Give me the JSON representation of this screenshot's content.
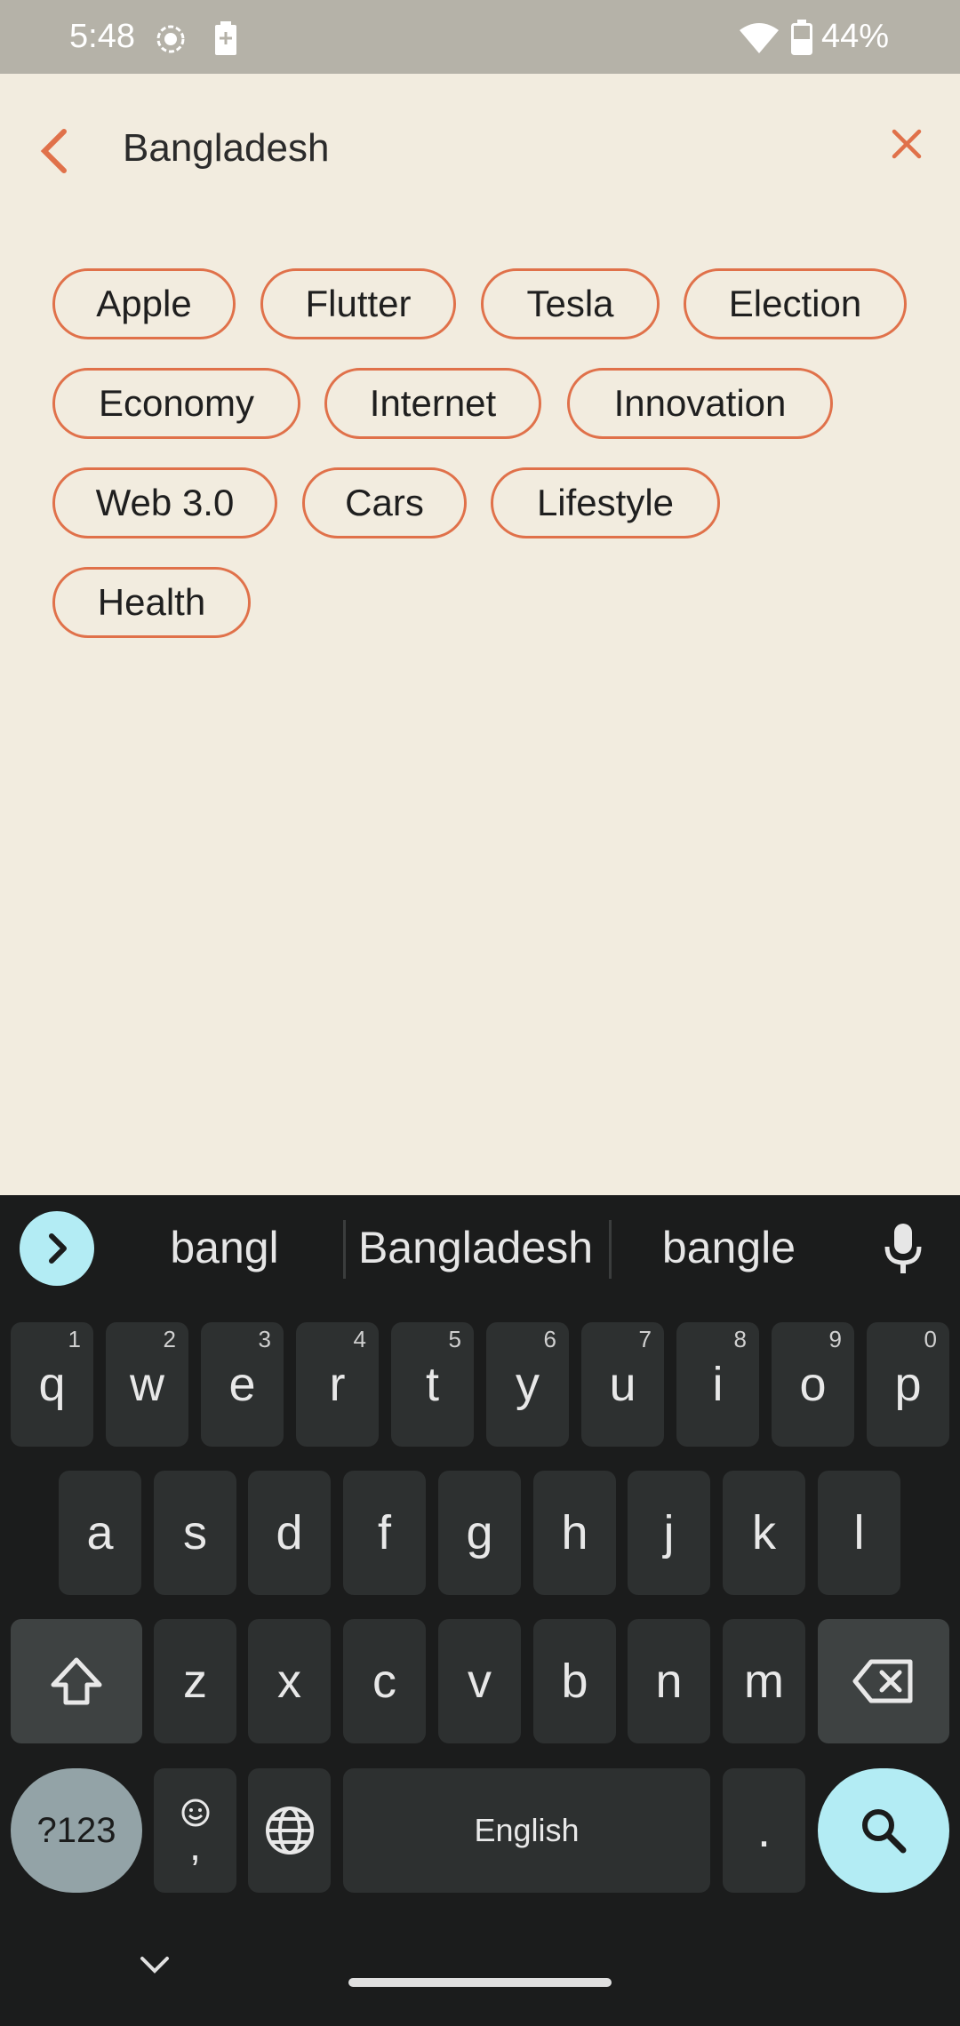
{
  "status_bar": {
    "time": "5:48",
    "battery_percent": "44%"
  },
  "header": {
    "search_value": "Bangladesh"
  },
  "chips": [
    "Apple",
    "Flutter",
    "Tesla",
    "Election",
    "Economy",
    "Internet",
    "Innovation",
    "Web 3.0",
    "Cars",
    "Lifestyle",
    "Health"
  ],
  "keyboard": {
    "suggestions": [
      "bangl",
      "Bangladesh",
      "bangle"
    ],
    "row1": [
      "q",
      "w",
      "e",
      "r",
      "t",
      "y",
      "u",
      "i",
      "o",
      "p"
    ],
    "row1_hints": [
      "1",
      "2",
      "3",
      "4",
      "5",
      "6",
      "7",
      "8",
      "9",
      "0"
    ],
    "row2": [
      "a",
      "s",
      "d",
      "f",
      "g",
      "h",
      "j",
      "k",
      "l"
    ],
    "row3": [
      "z",
      "x",
      "c",
      "v",
      "b",
      "n",
      "m"
    ],
    "symbols_label": "?123",
    "comma_label": ",",
    "space_label": "English",
    "period_label": "."
  },
  "colors": {
    "accent": "#E0714A",
    "background": "#F2ECDF",
    "keyboard_bg": "#1B1C1C",
    "key_bg": "#2D3030",
    "search_key": "#B3ECF4"
  }
}
